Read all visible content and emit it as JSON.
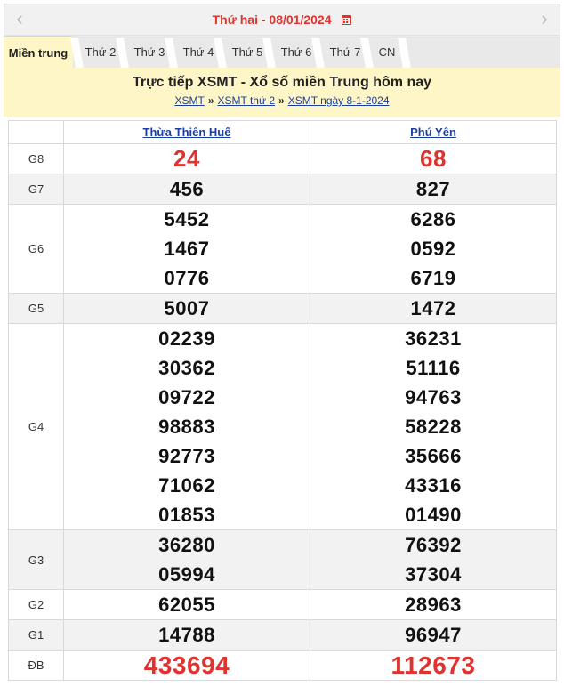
{
  "datebar": {
    "prev_icon": "chevron-left-icon",
    "next_icon": "chevron-right-icon",
    "day": "Thứ hai -",
    "date": "08/01/2024",
    "calendar_icon": "calendar-icon"
  },
  "tabs": [
    {
      "label": "Miền trung",
      "active": true
    },
    {
      "label": "Thứ 2"
    },
    {
      "label": "Thứ 3"
    },
    {
      "label": "Thứ 4"
    },
    {
      "label": "Thứ 5"
    },
    {
      "label": "Thứ 6"
    },
    {
      "label": "Thứ 7"
    },
    {
      "label": "CN"
    }
  ],
  "header": {
    "title": "Trực tiếp XSMT - Xổ số miền Trung hôm nay",
    "crumbs": [
      "XSMT",
      "XSMT thứ 2",
      "XSMT ngày 8-1-2024"
    ],
    "separator": "»"
  },
  "table": {
    "provinces": [
      "Thừa Thiên Huế",
      "Phú Yên"
    ],
    "rows": [
      {
        "label": "G8",
        "style": "red-big",
        "alt": false,
        "left": [
          "24"
        ],
        "right": [
          "68"
        ]
      },
      {
        "label": "G7",
        "alt": true,
        "left": [
          "456"
        ],
        "right": [
          "827"
        ]
      },
      {
        "label": "G6",
        "alt": false,
        "left": [
          "5452",
          "1467",
          "0776"
        ],
        "right": [
          "6286",
          "0592",
          "6719"
        ]
      },
      {
        "label": "G5",
        "alt": true,
        "left": [
          "5007"
        ],
        "right": [
          "1472"
        ]
      },
      {
        "label": "G4",
        "alt": false,
        "left": [
          "02239",
          "30362",
          "09722",
          "98883",
          "92773",
          "71062",
          "01853"
        ],
        "right": [
          "36231",
          "51116",
          "94763",
          "58228",
          "35666",
          "43316",
          "01490"
        ]
      },
      {
        "label": "G3",
        "alt": true,
        "left": [
          "36280",
          "05994"
        ],
        "right": [
          "76392",
          "37304"
        ]
      },
      {
        "label": "G2",
        "alt": false,
        "left": [
          "62055"
        ],
        "right": [
          "28963"
        ]
      },
      {
        "label": "G1",
        "alt": true,
        "left": [
          "14788"
        ],
        "right": [
          "96947"
        ]
      },
      {
        "label": "ĐB",
        "style": "red-xl",
        "alt": false,
        "left": [
          "433694"
        ],
        "right": [
          "112673"
        ]
      }
    ]
  },
  "colors": {
    "accent_red": "#e0322e",
    "link_blue": "#1a3fa1",
    "header_bg": "#fff6c7"
  }
}
